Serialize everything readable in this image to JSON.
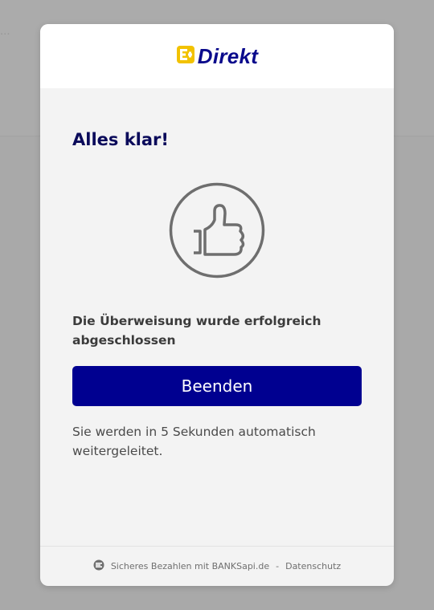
{
  "background": {
    "partial_text": "..."
  },
  "modal": {
    "logo": {
      "text": "Direkt",
      "icon": "eplus-logo-icon",
      "brand_blue": "#0a0a8c",
      "brand_yellow": "#f2c200"
    },
    "title": "Alles klar!",
    "success_icon": "thumbs-up-circle-icon",
    "message": "Die Überweisung wurde erfolgreich abgeschlossen",
    "finish_button_label": "Beenden",
    "redirect_text": "Sie werden in 5 Sekunden automatisch weitergeleitet.",
    "accent_color": "#000090"
  },
  "footer": {
    "icon": "banksapi-icon",
    "secure_text": "Sicheres Bezahlen mit BANKSapi.de",
    "separator": "-",
    "privacy_link": "Datenschutz"
  }
}
